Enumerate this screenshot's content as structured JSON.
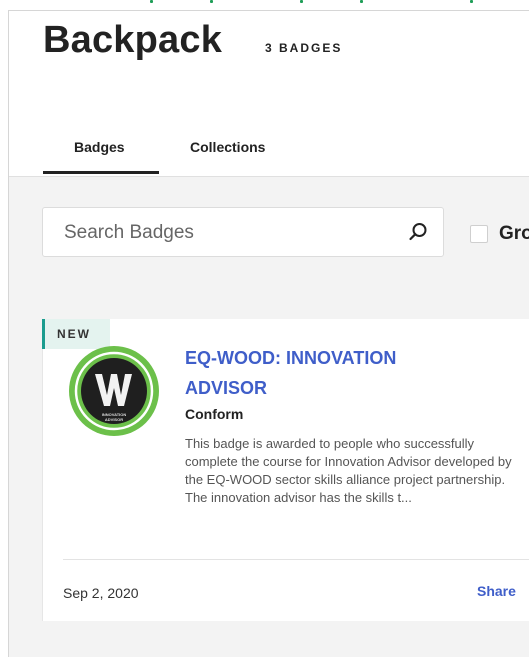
{
  "header": {
    "title": "Backpack",
    "count": "3 BADGES"
  },
  "tabs": [
    {
      "label": "Badges",
      "active": true
    },
    {
      "label": "Collections",
      "active": false
    }
  ],
  "search": {
    "placeholder": "Search Badges",
    "icon": "search-icon"
  },
  "group_toggle": {
    "label": "Gro",
    "checked": false
  },
  "badge_card": {
    "ribbon": "NEW",
    "title": "EQ-WOOD: INNOVATION ADVISOR",
    "issuer": "Conform",
    "description": "This badge is awarded to people who successfully complete the course for Innovation Advisor developed by the EQ-WOOD sector skills alliance project partnership. The innovation advisor has the skills t...",
    "date": "Sep 2, 2020",
    "share_label": "Share",
    "image_icon": "innovation-advisor-badge-icon",
    "image_text": "INNOVATION ADVISOR"
  },
  "colors": {
    "accent": "#3f5ec9",
    "ribbon_border": "#1a9c8e",
    "ribbon_bg": "#e4f3ef",
    "badge_green": "#6cc04a",
    "top_accent": "#1e9d57"
  }
}
